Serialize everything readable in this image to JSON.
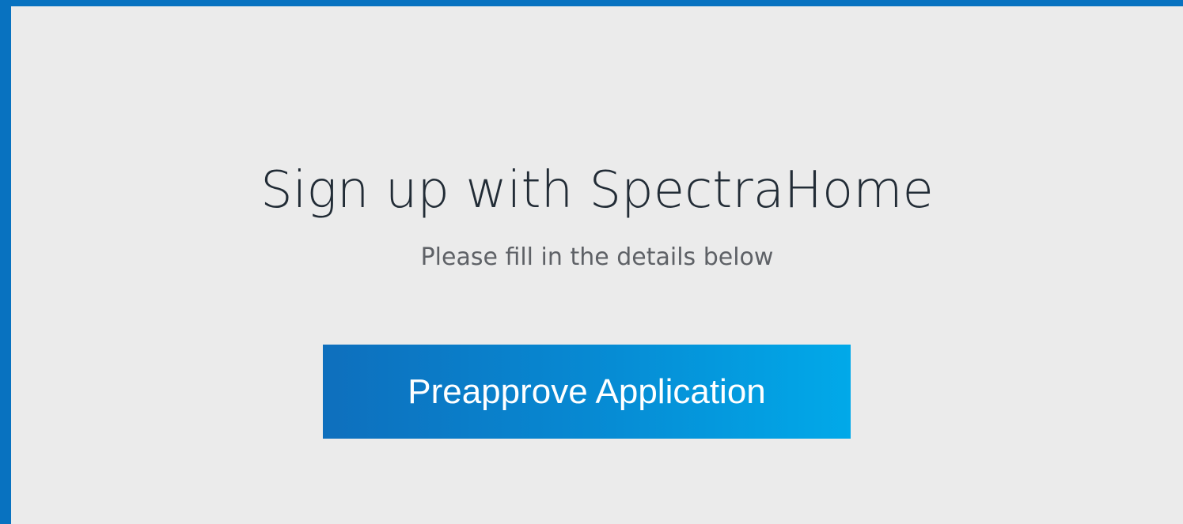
{
  "signup": {
    "title": "Sign up with SpectraHome",
    "subtitle": "Please fill in the details below",
    "button_label": "Preapprove Application"
  },
  "colors": {
    "frame": "#0872c0",
    "panel_background": "#ebebeb",
    "title_text": "#222c36",
    "subtitle_text": "#5e6166",
    "button_gradient_start": "#0e6fbd",
    "button_gradient_end": "#01a9e9",
    "button_text": "#ffffff"
  }
}
